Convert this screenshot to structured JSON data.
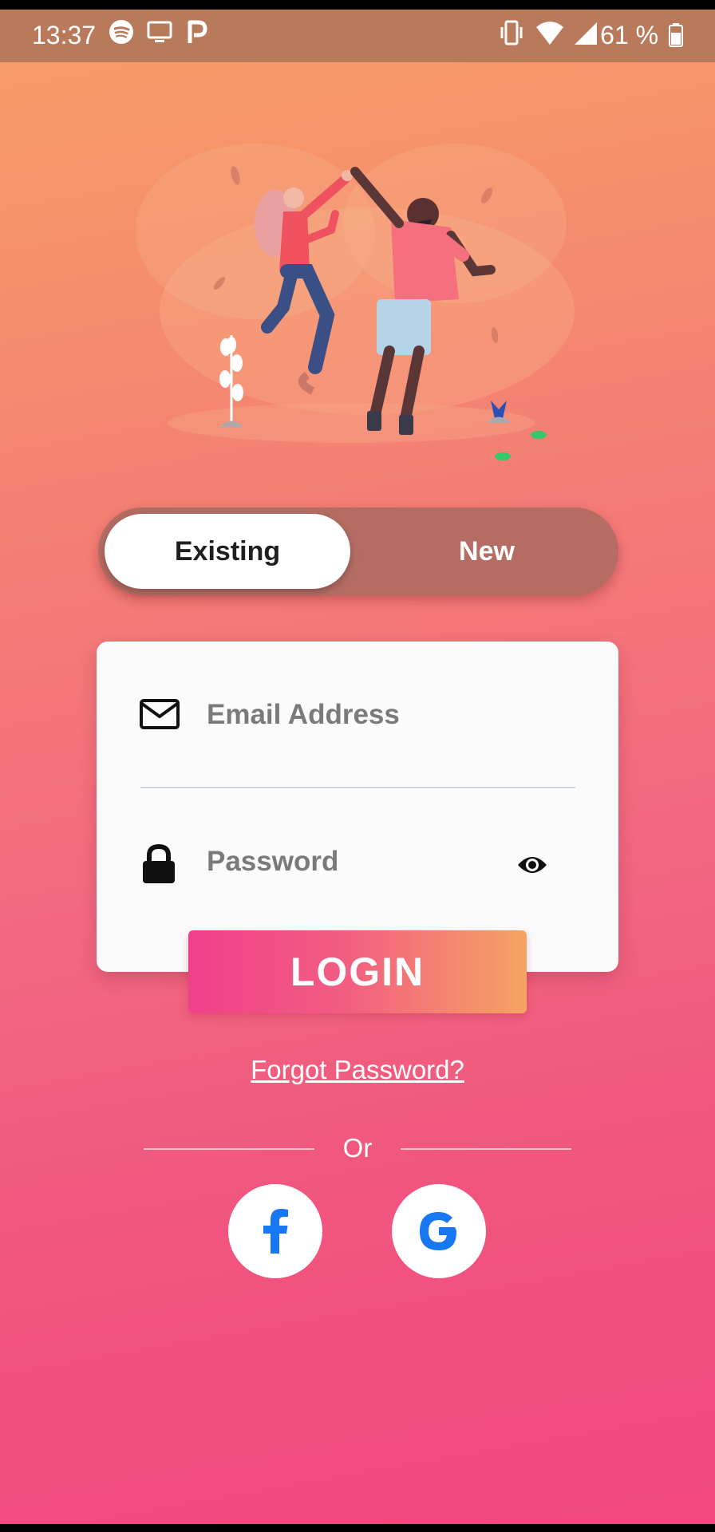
{
  "status_bar": {
    "time": "13:37",
    "battery": "61 %",
    "icons": [
      "spotify-icon",
      "cast-icon",
      "p-app-icon",
      "vibrate-icon",
      "wifi-icon",
      "signal-icon",
      "battery-icon"
    ]
  },
  "auth_toggle": {
    "existing_label": "Existing",
    "new_label": "New",
    "selected": "Existing"
  },
  "login_form": {
    "email_placeholder": "Email Address",
    "password_placeholder": "Password",
    "login_label": "LOGIN"
  },
  "links": {
    "forgot_password": "Forgot Password?"
  },
  "social": {
    "or_label": "Or",
    "facebook_glyph": "f",
    "google_glyph": "G"
  },
  "colors": {
    "gradient_top": "#f7a065",
    "gradient_bottom": "#f0477f",
    "toggle_track": "#b56d63",
    "login_gradient_start": "#f0408a",
    "login_gradient_end": "#f5a462",
    "social_brand": "#1877f2"
  }
}
